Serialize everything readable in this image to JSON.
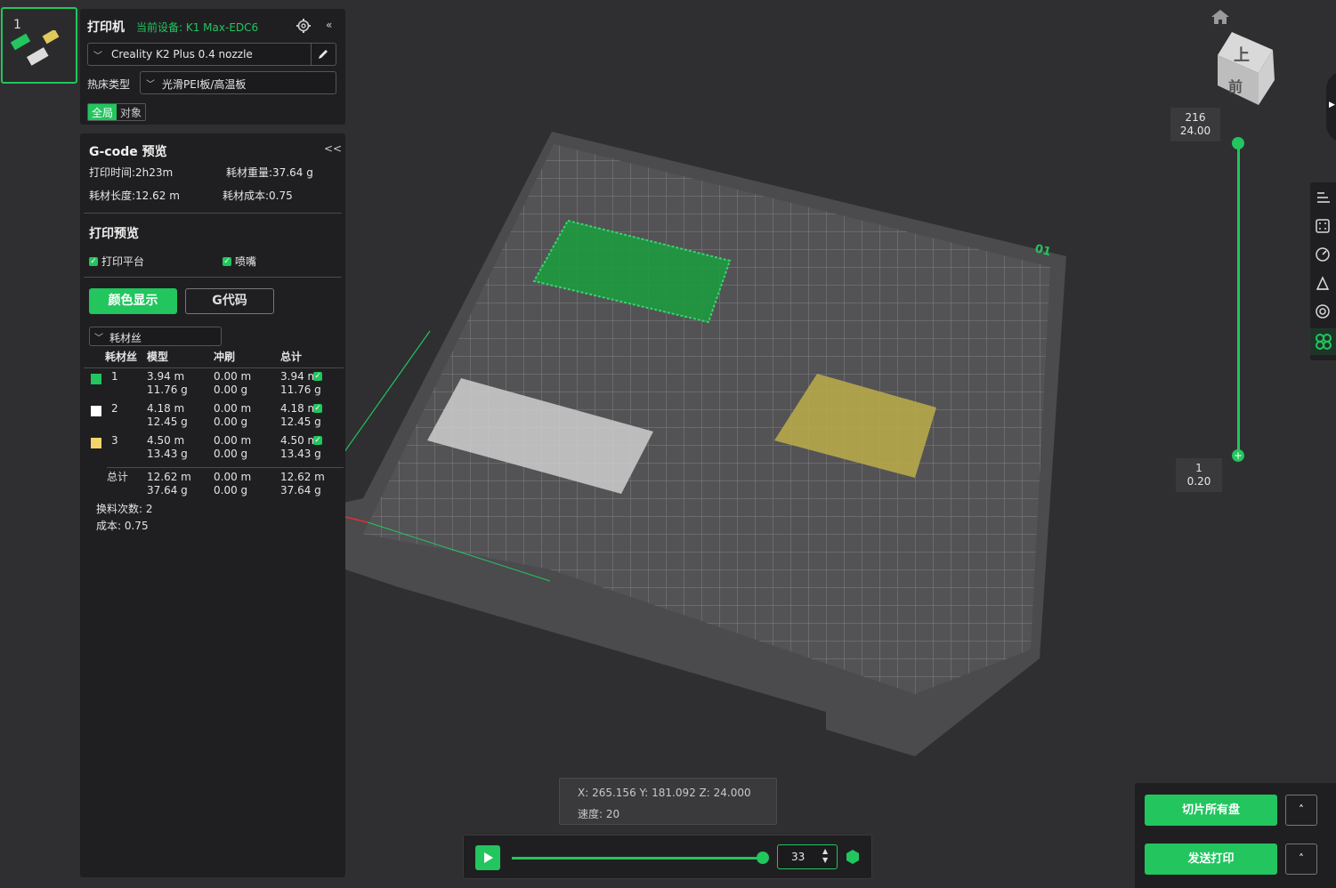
{
  "plate_thumb": {
    "index": "1"
  },
  "printer": {
    "title": "打印机",
    "current_device": "当前设备: K1 Max-EDC6",
    "preset": "Creality K2 Plus 0.4 nozzle",
    "bed_label": "热床类型",
    "bed_value": "光滑PEI板/高温板",
    "scope_global": "全局",
    "scope_object": "对象"
  },
  "gcode": {
    "title": "G-code 预览",
    "collapse": "<<",
    "print_time": "打印时间:2h23m",
    "filament_weight": "耗材重量:37.64 g",
    "filament_length": "耗材长度:12.62 m",
    "filament_cost": "耗材成本:0.75",
    "preview_title": "打印预览",
    "opt_plate": "打印平台",
    "opt_nozzle": "喷嘴",
    "btn_color": "颜色显示",
    "btn_gcode": "G代码",
    "view_select": "耗材丝",
    "headers": [
      "耗材丝",
      "模型",
      "冲刷",
      "总计"
    ],
    "rows": [
      {
        "id": "1",
        "color": "#22c55e",
        "model_m": "3.94 m",
        "model_g": "11.76 g",
        "flush_m": "0.00 m",
        "flush_g": "0.00 g",
        "total_m": "3.94 m",
        "total_g": "11.76 g"
      },
      {
        "id": "2",
        "color": "#ffffff",
        "model_m": "4.18 m",
        "model_g": "12.45 g",
        "flush_m": "0.00 m",
        "flush_g": "0.00 g",
        "total_m": "4.18 m",
        "total_g": "12.45 g"
      },
      {
        "id": "3",
        "color": "#f2d66b",
        "model_m": "4.50 m",
        "model_g": "13.43 g",
        "flush_m": "0.00 m",
        "flush_g": "0.00 g",
        "total_m": "4.50 m",
        "total_g": "13.43 g"
      }
    ],
    "sum_label": "总计",
    "sum": {
      "model_m": "12.62 m",
      "model_g": "37.64 g",
      "flush_m": "0.00 m",
      "flush_g": "0.00 g",
      "total_m": "12.62 m",
      "total_g": "37.64 g"
    },
    "changes": "换料次数:  2",
    "cost": "成本:  0.75"
  },
  "viewport": {
    "plate_label": "01",
    "cube_top": "上",
    "cube_front": "前",
    "layer_top": "216",
    "layer_top_h": "24.00",
    "layer_bottom": "1",
    "layer_bottom_h": "0.20",
    "coords": "X: 265.156  Y: 181.092  Z: 24.000",
    "speed": "速度: 20",
    "progress_value": "33",
    "progress": 1.0
  },
  "actions": {
    "slice_all": "切片所有盘",
    "send_print": "发送打印",
    "caret": "˄"
  },
  "colors": {
    "accent": "#22c55e"
  }
}
